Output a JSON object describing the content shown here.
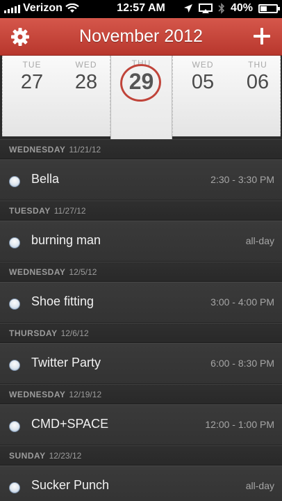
{
  "status": {
    "carrier": "Verizon",
    "time": "12:57 AM",
    "battery": "40%",
    "battery_level": 0.4
  },
  "header": {
    "title": "November 2012"
  },
  "strip": {
    "days": [
      {
        "dow": "TUE",
        "num": "27"
      },
      {
        "dow": "WED",
        "num": "28"
      },
      {
        "dow": "WED",
        "num": "05"
      },
      {
        "dow": "THU",
        "num": "06"
      }
    ],
    "selected": {
      "dow": "THU",
      "num": "29"
    }
  },
  "events": [
    {
      "weekday": "WEDNESDAY",
      "date": "11/21/12",
      "title": "Bella",
      "time": "2:30 - 3:30 PM"
    },
    {
      "weekday": "TUESDAY",
      "date": "11/27/12",
      "title": "burning man",
      "time": "all-day"
    },
    {
      "weekday": "WEDNESDAY",
      "date": "12/5/12",
      "title": "Shoe fitting",
      "time": "3:00 - 4:00 PM"
    },
    {
      "weekday": "THURSDAY",
      "date": "12/6/12",
      "title": "Twitter Party",
      "time": "6:00 - 8:30 PM"
    },
    {
      "weekday": "WEDNESDAY",
      "date": "12/19/12",
      "title": "CMD+SPACE",
      "time": "12:00 - 1:00 PM"
    },
    {
      "weekday": "SUNDAY",
      "date": "12/23/12",
      "title": "Sucker Punch",
      "time": "all-day"
    }
  ],
  "colors": {
    "header_red": "#c4453a",
    "list_bg": "#333333",
    "section_bg": "#2b2b2b"
  }
}
